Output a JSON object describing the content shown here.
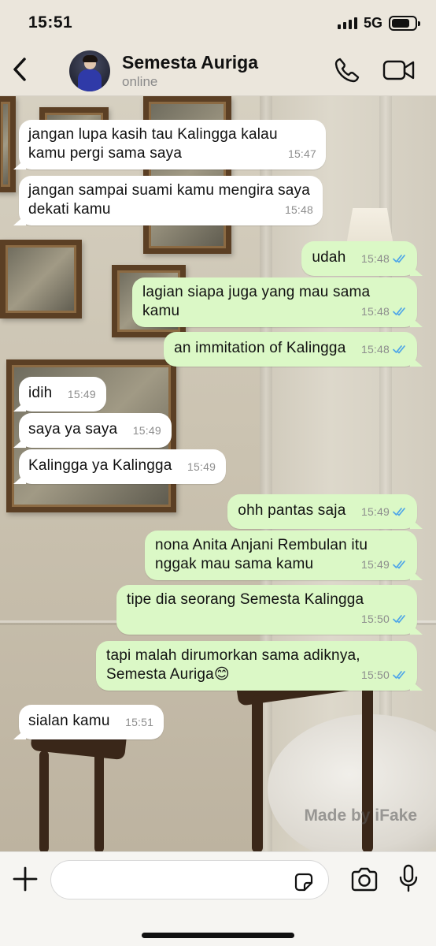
{
  "status_bar": {
    "time": "15:51",
    "network": "5G"
  },
  "header": {
    "contact_name": "Semesta Auriga",
    "contact_status": "online"
  },
  "messages": [
    {
      "direction": "in",
      "text": "jangan lupa kasih tau Kalingga kalau kamu pergi sama saya",
      "time": "15:47"
    },
    {
      "direction": "in",
      "text": "jangan sampai suami kamu mengira saya dekati kamu",
      "time": "15:48"
    },
    {
      "direction": "out",
      "text": "udah",
      "time": "15:48",
      "read": true
    },
    {
      "direction": "out",
      "text": "lagian siapa juga yang mau sama kamu",
      "time": "15:48",
      "read": true
    },
    {
      "direction": "out",
      "text": "an immitation of Kalingga",
      "time": "15:48",
      "read": true
    },
    {
      "direction": "in",
      "text": "idih",
      "time": "15:49"
    },
    {
      "direction": "in",
      "text": "saya ya saya",
      "time": "15:49"
    },
    {
      "direction": "in",
      "text": "Kalingga ya Kalingga",
      "time": "15:49"
    },
    {
      "direction": "out",
      "text": "ohh pantas saja",
      "time": "15:49",
      "read": true
    },
    {
      "direction": "out",
      "text": "nona Anita Anjani Rembulan itu nggak mau sama kamu",
      "time": "15:49",
      "read": true
    },
    {
      "direction": "out",
      "text": "tipe dia seorang Semesta Kalingga",
      "time": "15:50",
      "read": true
    },
    {
      "direction": "out",
      "text": "tapi malah dirumorkan sama adiknya, Semesta Auriga😊",
      "time": "15:50",
      "read": true
    },
    {
      "direction": "in",
      "text": "sialan kamu",
      "time": "15:51"
    }
  ],
  "watermark": "Made by iFake",
  "input": {
    "placeholder": "",
    "value": ""
  },
  "colors": {
    "incoming_bubble": "#ffffff",
    "outgoing_bubble": "#dbf8c6",
    "read_ticks": "#4fa6e8",
    "header_bg": "#ece7de"
  },
  "icons": [
    "back-icon",
    "phone-icon",
    "video-call-icon",
    "plus-icon",
    "sticker-icon",
    "camera-icon",
    "microphone-icon",
    "double-check-icon"
  ]
}
